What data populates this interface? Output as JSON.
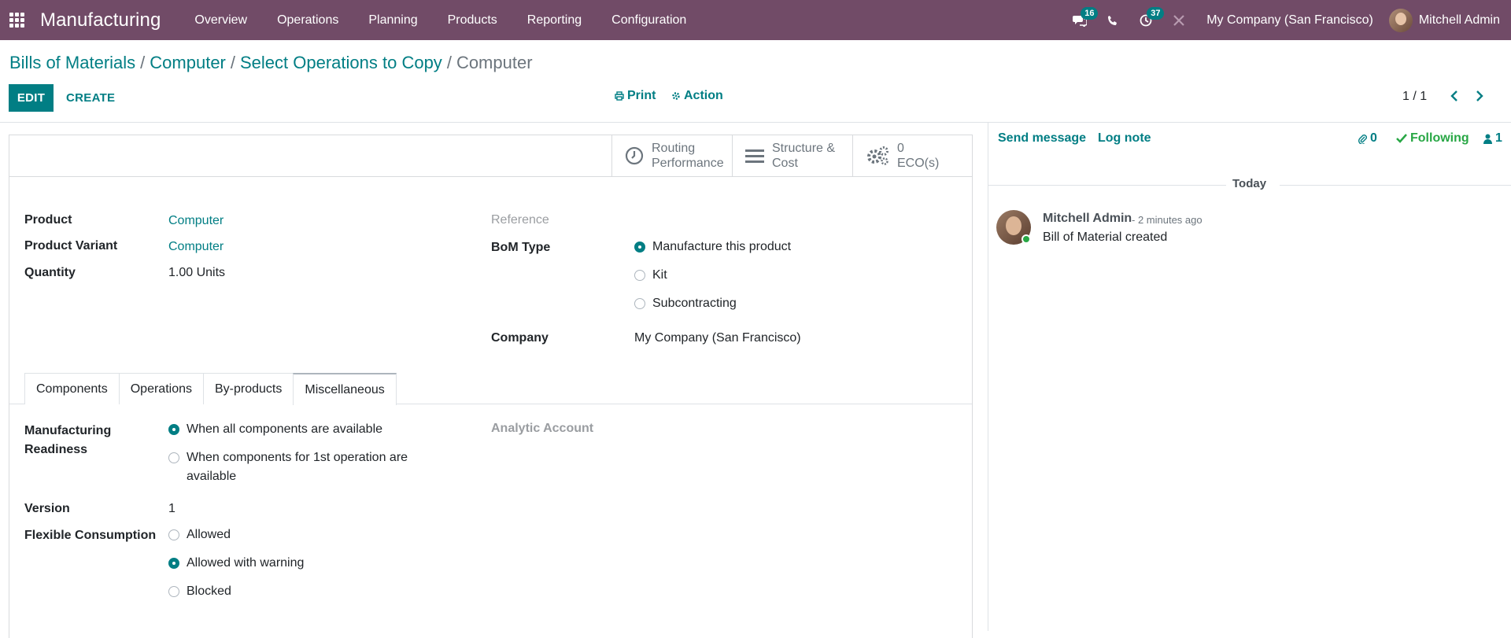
{
  "topbar": {
    "app_name": "Manufacturing",
    "menu": [
      "Overview",
      "Operations",
      "Planning",
      "Products",
      "Reporting",
      "Configuration"
    ],
    "messages_count": "16",
    "activities_count": "37",
    "company": "My Company (San Francisco)",
    "user": "Mitchell Admin",
    "accent_color": "#714B67"
  },
  "breadcrumb": {
    "items": [
      "Bills of Materials",
      "Computer",
      "Select Operations to Copy"
    ],
    "current": "Computer"
  },
  "controls": {
    "edit": "EDIT",
    "create": "CREATE",
    "print": "Print",
    "action": "Action",
    "pager": "1 / 1"
  },
  "stat_buttons": {
    "routing": [
      "Routing",
      "Performance"
    ],
    "structure": [
      "Structure &",
      "Cost"
    ],
    "eco_count": "0",
    "eco_label": "ECO(s)"
  },
  "form": {
    "product_label": "Product",
    "product_value": "Computer",
    "variant_label": "Product Variant",
    "variant_value": "Computer",
    "quantity_label": "Quantity",
    "quantity_value": "1.00",
    "quantity_uom": "Units",
    "reference_label": "Reference",
    "bom_type_label": "BoM Type",
    "bom_types": [
      "Manufacture this product",
      "Kit",
      "Subcontracting"
    ],
    "bom_type_selected": "Manufacture this product",
    "company_label": "Company",
    "company_value": "My Company (San Francisco)"
  },
  "tabs": [
    "Components",
    "Operations",
    "By-products",
    "Miscellaneous"
  ],
  "active_tab": "Miscellaneous",
  "misc": {
    "readiness_label_1": "Manufacturing",
    "readiness_label_2": "Readiness",
    "readiness_opt1": "When all components are available",
    "readiness_opt2_line1": "When components for 1st operation are",
    "readiness_opt2_line2": "available",
    "analytic_label": "Analytic Account",
    "version_label": "Version",
    "version_value": "1",
    "flex_label": "Flexible Consumption",
    "flex_options": [
      "Allowed",
      "Allowed with warning",
      "Blocked"
    ],
    "flex_selected": "Allowed with warning"
  },
  "chatter": {
    "send_message": "Send message",
    "log_note": "Log note",
    "attachments": "0",
    "following": "Following",
    "followers": "1",
    "today": "Today",
    "author": "Mitchell Admin",
    "date": "- 2 minutes ago",
    "body": "Bill of Material created"
  }
}
